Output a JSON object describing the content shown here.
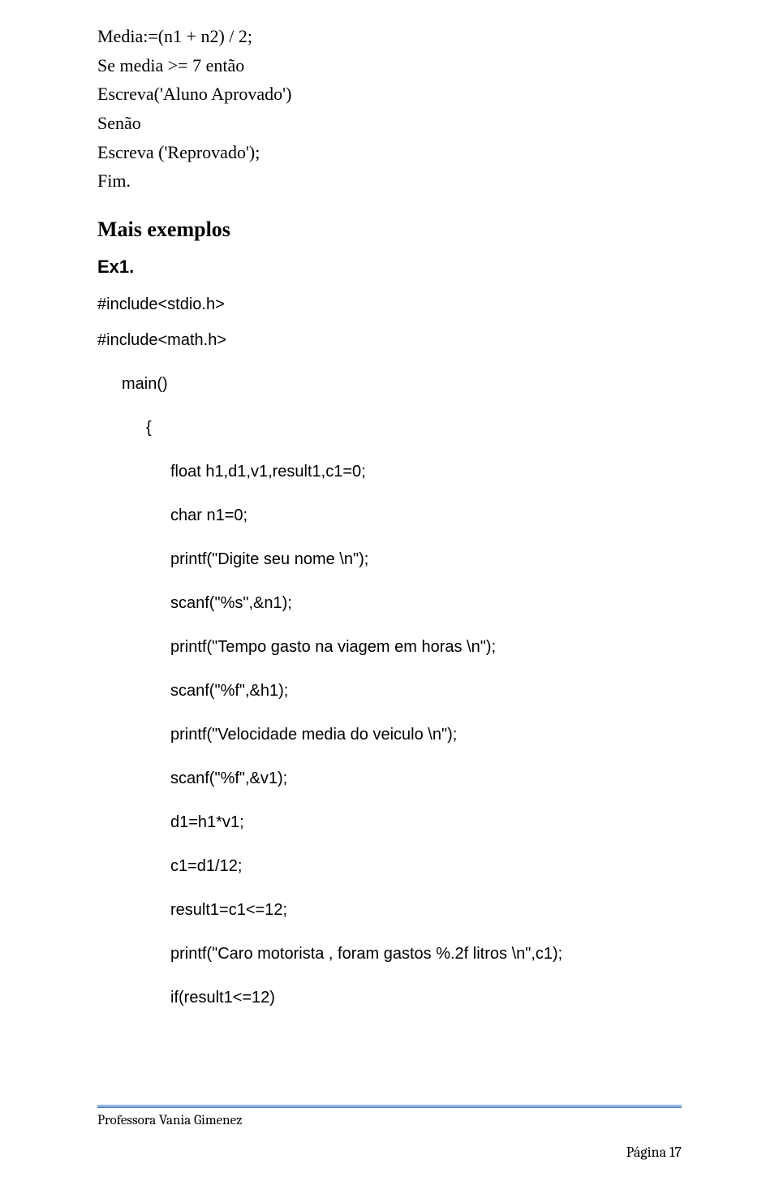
{
  "code_top": {
    "l1": "Media:=(n1 + n2) / 2;",
    "l2": "Se media >= 7 então",
    "l3": "Escreva('Aluno Aprovado')",
    "l4": "Senão",
    "l5": "Escreva ('Reprovado');",
    "l6": "Fim."
  },
  "heading1": "Mais exemplos",
  "heading2": "Ex1.",
  "code_main": {
    "l1": "#include<stdio.h>",
    "l2": "#include<math.h>",
    "l3": "main()",
    "l4": "{",
    "l5": "float h1,d1,v1,result1,c1=0;",
    "l6": "char n1=0;",
    "l7": "printf(\"Digite seu nome \\n\");",
    "l8": "scanf(\"%s\",&n1);",
    "l9": "printf(\"Tempo gasto na viagem em horas \\n\");",
    "l10": "scanf(\"%f\",&h1);",
    "l11": "printf(\"Velocidade media do veiculo \\n\");",
    "l12": "scanf(\"%f\",&v1);",
    "l13": "d1=h1*v1;",
    "l14": "c1=d1/12;",
    "l15": "result1=c1<=12;",
    "l16": "printf(\"Caro motorista , foram gastos %.2f litros \\n\",c1);",
    "l17": "if(result1<=12)"
  },
  "footer": {
    "text": "Professora Vania Gimenez",
    "page": "Página 17"
  }
}
